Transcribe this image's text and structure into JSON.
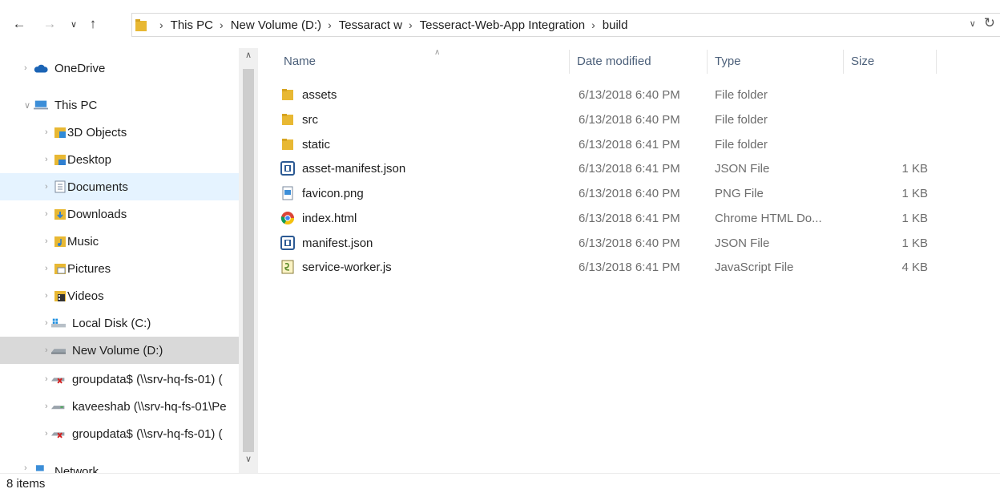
{
  "address_bar": {
    "breadcrumbs": [
      "This PC",
      "New Volume (D:)",
      "Tessaract w",
      "Tesseract-Web-App Integration",
      "build"
    ]
  },
  "sidebar": {
    "items": [
      {
        "label": "OneDrive",
        "icon": "cloud-icon"
      },
      {
        "label": "This PC",
        "icon": "computer-icon"
      },
      {
        "label": "3D Objects",
        "icon": "cube-folder-icon"
      },
      {
        "label": "Desktop",
        "icon": "desktop-folder-icon"
      },
      {
        "label": "Documents",
        "icon": "documents-folder-icon"
      },
      {
        "label": "Downloads",
        "icon": "downloads-folder-icon"
      },
      {
        "label": "Music",
        "icon": "music-folder-icon"
      },
      {
        "label": "Pictures",
        "icon": "pictures-folder-icon"
      },
      {
        "label": "Videos",
        "icon": "videos-folder-icon"
      },
      {
        "label": "Local Disk (C:)",
        "icon": "windows-drive-icon"
      },
      {
        "label": "New Volume (D:)",
        "icon": "drive-icon"
      },
      {
        "label": "groupdata$ (\\\\srv-hq-fs-01) (",
        "icon": "disconnected-network-drive-icon"
      },
      {
        "label": "kaveeshab (\\\\srv-hq-fs-01\\Pe",
        "icon": "network-drive-icon"
      },
      {
        "label": "groupdata$ (\\\\srv-hq-fs-01) (",
        "icon": "disconnected-network-drive-icon"
      },
      {
        "label": "Network",
        "icon": "network-icon"
      }
    ]
  },
  "columns": {
    "name": "Name",
    "date": "Date modified",
    "type": "Type",
    "size": "Size"
  },
  "files": [
    {
      "name": "assets",
      "date": "6/13/2018 6:40 PM",
      "type": "File folder",
      "size": "",
      "icon": "folder-icon"
    },
    {
      "name": "src",
      "date": "6/13/2018 6:40 PM",
      "type": "File folder",
      "size": "",
      "icon": "folder-icon"
    },
    {
      "name": "static",
      "date": "6/13/2018 6:41 PM",
      "type": "File folder",
      "size": "",
      "icon": "folder-icon"
    },
    {
      "name": "asset-manifest.json",
      "date": "6/13/2018 6:41 PM",
      "type": "JSON File",
      "size": "1 KB",
      "icon": "json-file-icon"
    },
    {
      "name": "favicon.png",
      "date": "6/13/2018 6:40 PM",
      "type": "PNG File",
      "size": "1 KB",
      "icon": "image-file-icon"
    },
    {
      "name": "index.html",
      "date": "6/13/2018 6:41 PM",
      "type": "Chrome HTML Do...",
      "size": "1 KB",
      "icon": "chrome-icon"
    },
    {
      "name": "manifest.json",
      "date": "6/13/2018 6:40 PM",
      "type": "JSON File",
      "size": "1 KB",
      "icon": "json-file-icon"
    },
    {
      "name": "service-worker.js",
      "date": "6/13/2018 6:41 PM",
      "type": "JavaScript File",
      "size": "4 KB",
      "icon": "script-file-icon"
    }
  ],
  "status": {
    "item_count": "8 items"
  },
  "colors": {
    "folder": "#e8b833",
    "selection_light": "#e5f3ff",
    "selection_grey": "#d9d9d9",
    "header_text": "#4c607a"
  }
}
